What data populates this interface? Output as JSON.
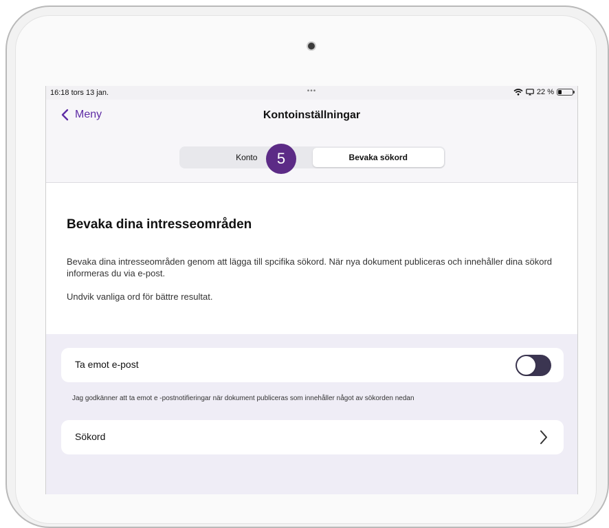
{
  "status_bar": {
    "time": "16:18  tors 13 jan.",
    "dots": "•••",
    "battery_text": "22 %",
    "battery_level_percent": 22
  },
  "nav": {
    "back_label": "Meny",
    "title": "Kontoinställningar"
  },
  "segmented": {
    "tabs": [
      "Konto",
      "Bevaka sökord"
    ],
    "selected_index": 1
  },
  "step_badge": "5",
  "intro": {
    "heading": "Bevaka dina intresseområden",
    "paragraph": "Bevaka dina intresseområden genom att lägga till spcifika sökord. När nya dokument publiceras och innehåller dina sökord informeras du via e-post.",
    "hint": "Undvik vanliga ord för bättre resultat."
  },
  "email_row": {
    "label": "Ta emot e-post",
    "toggle_state": "off",
    "caption": "Jag godkänner att ta emot e -postnotifieringar när dokument publiceras som innehåller något av sökorden nedan"
  },
  "keywords_row": {
    "label": "Sökord"
  },
  "colors": {
    "accent": "#5e2ca5",
    "badge": "#5c2b86",
    "toggle_track": "#3b3551",
    "settings_background": "#efedf6"
  }
}
